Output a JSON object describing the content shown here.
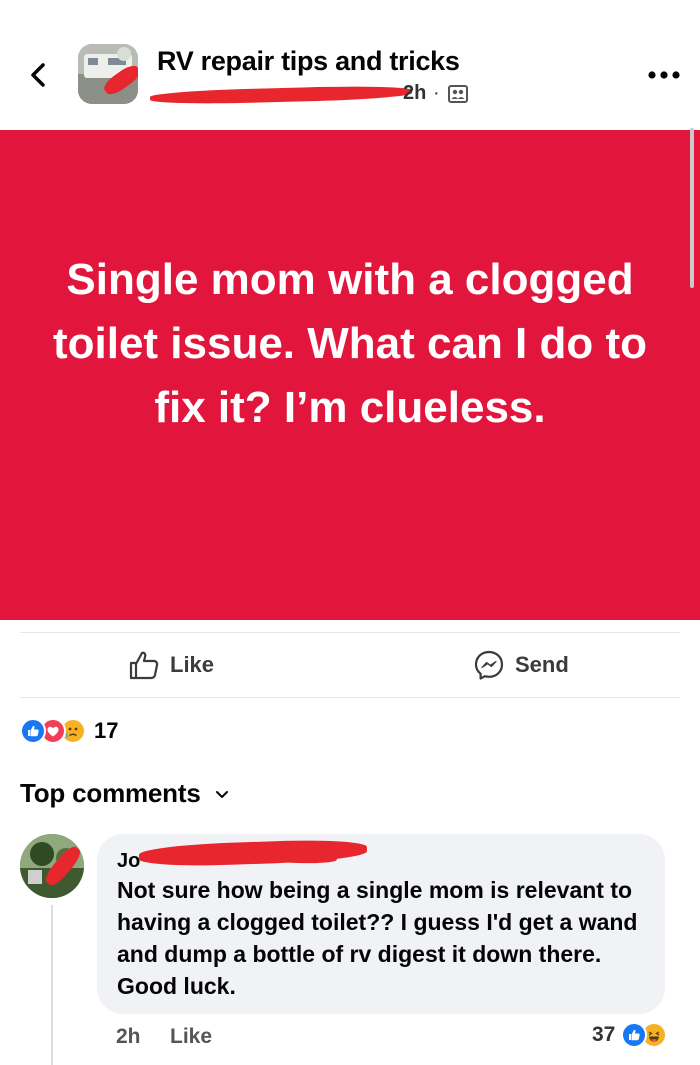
{
  "header": {
    "group_title": "RV repair tips and tricks",
    "time": "2h",
    "separator": "·"
  },
  "post": {
    "text": "Single mom with a clogged toilet issue. What can I do to fix it? I’m clueless.",
    "background_color": "#e2163d",
    "text_color": "#ffffff"
  },
  "actions": {
    "like_label": "Like",
    "send_label": "Send"
  },
  "reactions": {
    "count": "17",
    "types": [
      "like-icon",
      "love-icon",
      "care-icon"
    ]
  },
  "comments_section": {
    "title": "Top comments"
  },
  "comment": {
    "author": "Jo",
    "text": "Not sure how being a single mom is relevant to having a clogged toilet?? I guess I'd get a wand and dump a bottle of rv digest it down there. Good luck.",
    "time": "2h",
    "like_label": "Like",
    "reaction_count": "37",
    "reaction_types": [
      "like-icon",
      "haha-icon"
    ]
  },
  "colors": {
    "facebook_blue": "#1877f2",
    "redaction_red": "#e8262e"
  }
}
